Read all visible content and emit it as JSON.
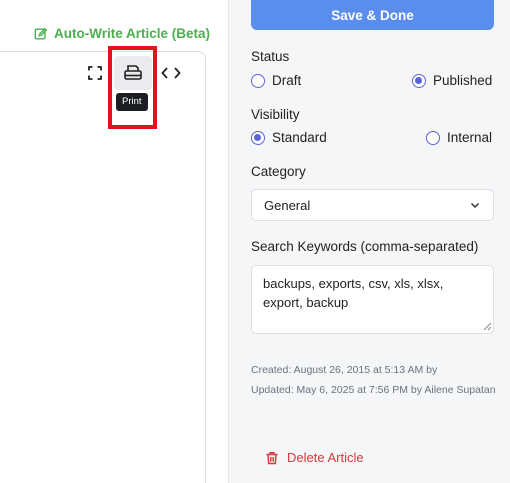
{
  "editor": {
    "auto_write_label": "Auto-Write Article (Beta)",
    "toolbar": {
      "fullscreen_icon": "fullscreen-icon",
      "print_icon": "printer-icon",
      "code_icon": "code-icon",
      "print_tooltip": "Print"
    }
  },
  "panel": {
    "save_label": "Save & Done",
    "status": {
      "label": "Status",
      "options": [
        "Draft",
        "Published"
      ],
      "selected": "Published"
    },
    "visibility": {
      "label": "Visibility",
      "options": [
        "Standard",
        "Internal"
      ],
      "selected": "Standard"
    },
    "category": {
      "label": "Category",
      "value": "General"
    },
    "keywords": {
      "label": "Search Keywords (comma-separated)",
      "value": "backups, exports, csv, xls, xlsx, export, backup"
    },
    "created": "Created: August 26, 2015 at 5:13 AM by",
    "updated": "Updated: May 6, 2025 at 7:56 PM by Ailene Supatan",
    "delete_label": "Delete Article"
  },
  "colors": {
    "accent": "#5b8def",
    "radio": "#5b63d8",
    "green": "#4caf50",
    "danger": "#d63a3a",
    "highlight": "#e3131b"
  }
}
